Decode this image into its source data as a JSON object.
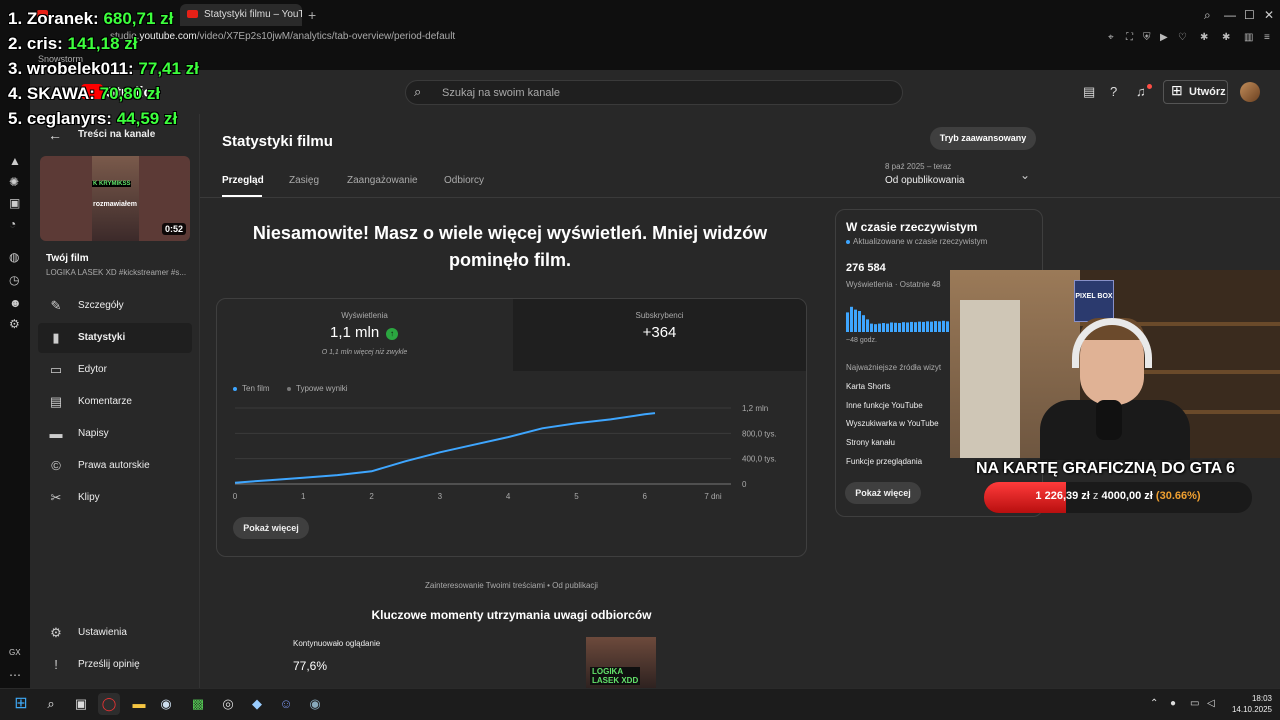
{
  "browser": {
    "tabs": [
      {
        "label": "Statystyki filmu – YouTube"
      }
    ],
    "url_prefix": "studio.",
    "url_host": "youtube.com",
    "url_path": "/video/X7Ep2s10jwM/analytics/tab-overview/period-default",
    "bookmark": "Snowstorm"
  },
  "header": {
    "logo_text": "Studio",
    "search_placeholder": "Szukaj na swoim kanale",
    "create_label": "Utwórz"
  },
  "sidebar": {
    "back_label": "Treści na kanale",
    "thumb_badge": "K KRYMIKSS",
    "thumb_caption": "rozmawiałem",
    "duration": "0:52",
    "your_film": "Twój film",
    "film_title": "LOGIKA LASEK XD #kickstreamer #s...",
    "items": [
      {
        "label": "Szczegóły",
        "icon": "pencil-icon"
      },
      {
        "label": "Statystyki",
        "icon": "analytics-icon"
      },
      {
        "label": "Edytor",
        "icon": "editor-icon"
      },
      {
        "label": "Komentarze",
        "icon": "comments-icon"
      },
      {
        "label": "Napisy",
        "icon": "subtitles-icon"
      },
      {
        "label": "Prawa autorskie",
        "icon": "copyright-icon"
      },
      {
        "label": "Klipy",
        "icon": "scissors-icon"
      }
    ],
    "settings": "Ustawienia",
    "feedback": "Prześlij opinię"
  },
  "main": {
    "title": "Statystyki filmu",
    "advanced_mode": "Tryb zaawansowany",
    "date_range_small": "8 paź 2025 – teraz",
    "date_range": "Od opublikowania",
    "tabs": [
      "Przegląd",
      "Zasięg",
      "Zaangażowanie",
      "Odbiorcy"
    ],
    "headline": "Niesamowite! Masz o wiele więcej wyświetleń. Mniej widzów pominęło film.",
    "views_label": "Wyświetlenia",
    "views_value": "1,1 mln",
    "views_note": "O 1,1 mln więcej niż zwykle",
    "subs_label": "Subskrybenci",
    "subs_value": "+364",
    "legend_this": "Ten film",
    "legend_typical": "Typowe wyniki",
    "show_more": "Pokaż więcej",
    "engagement": "Zainteresowanie Twoimi treściami • Od publikacji",
    "key_moments_title": "Kluczowe momenty utrzymania uwagi odbiorców",
    "continued_label": "Kontynuowało oglądanie",
    "continued_value": "77,6%",
    "key_thumb_line1": "LOGIKA",
    "key_thumb_line2": "LASEK XDD"
  },
  "chart_data": {
    "type": "line",
    "x": [
      0,
      0.5,
      1,
      1.5,
      2,
      2.5,
      3,
      3.5,
      4,
      4.5,
      5,
      5.5,
      6,
      6.15
    ],
    "series": [
      {
        "name": "Ten film",
        "color": "#3ea6ff",
        "values": [
          0.02,
          0.06,
          0.1,
          0.14,
          0.2,
          0.36,
          0.5,
          0.62,
          0.74,
          0.88,
          0.96,
          1.02,
          1.1,
          1.12
        ]
      }
    ],
    "x_ticks": [
      "0",
      "1",
      "2",
      "3",
      "4",
      "5",
      "6",
      "7 dni"
    ],
    "y_ticks": [
      "0",
      "400,0 tys.",
      "800,0 tys.",
      "1,2 mln"
    ],
    "xlim": [
      0,
      7
    ],
    "ylim": [
      0,
      1.2
    ],
    "y_unit": "mln"
  },
  "realtime": {
    "title": "W czasie rzeczywistym",
    "updated": "Aktualizowane w czasie rzeczywistym",
    "count": "276 584",
    "count_label": "Wyświetlenia · Ostatnie 48",
    "hours": "~48 godz.",
    "sources_heading": "Najważniejsze źródła wizyt",
    "sources": [
      "Karta Shorts",
      "Inne funkcje YouTube",
      "Wyszukiwarka w YouTube",
      "Strony kanału",
      "Funkcje przeglądania"
    ],
    "show_more": "Pokaż więcej"
  },
  "overlay": {
    "pixelbox": "PIXEL BOX",
    "goal_title": "NA KARTĘ GRAFICZNĄ DO GTA 6",
    "goal_raised": "1 226,39 zł",
    "goal_of": "z",
    "goal_target": "4000,00 zł",
    "goal_pct_text": "(30.66%)",
    "goal_fraction": 0.3066,
    "donors": [
      {
        "name": "1. Zoranek:",
        "amount": "680,71 zł"
      },
      {
        "name": "2. cris:",
        "amount": "141,18 zł"
      },
      {
        "name": "3. wrobelek011:",
        "amount": "77,41 zł"
      },
      {
        "name": "4. SKAWA:",
        "amount": "70,80 zł"
      },
      {
        "name": "5. ceglanyrs:",
        "amount": "44,59 zł"
      }
    ]
  },
  "taskbar": {
    "time": "18:03",
    "date": "14.10.2025"
  }
}
